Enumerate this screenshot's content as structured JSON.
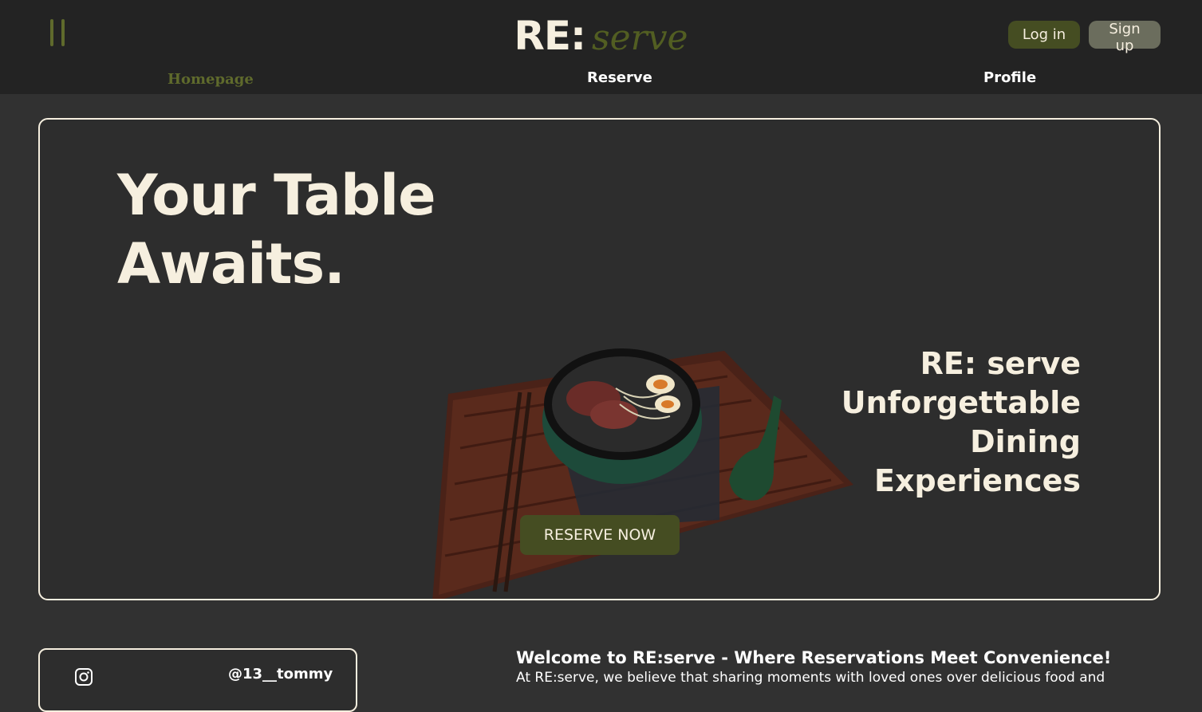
{
  "header": {
    "menu_icon": "pause-bars-icon",
    "brand": {
      "prefix": "RE:",
      "suffix": "serve"
    },
    "login_label": "Log in",
    "signup_label": "Sign up"
  },
  "nav": {
    "items": [
      {
        "label": "Homepage",
        "active": true
      },
      {
        "label": "Reserve",
        "active": false
      },
      {
        "label": "Profile",
        "active": false
      }
    ]
  },
  "hero": {
    "title_line1": "Your Table",
    "title_line2": "Awaits.",
    "tagline_line1": "RE: serve",
    "tagline_line2": "Unforgettable",
    "tagline_line3": "Dining",
    "tagline_line4": "Experiences",
    "cta_label": "RESERVE NOW",
    "illustration": "ramen-bowl-on-wooden-tray"
  },
  "social": {
    "icon": "instagram-icon",
    "handle": "@13__tommy"
  },
  "welcome": {
    "title": "Welcome to RE:serve - Where Reservations Meet Convenience!",
    "text": "At RE:serve, we believe that sharing moments with loved ones over delicious food and"
  },
  "colors": {
    "background": "#313131",
    "header": "#232323",
    "accent_olive": "#454d22",
    "brand_olive": "#525e22",
    "cream": "#f6efdf"
  }
}
